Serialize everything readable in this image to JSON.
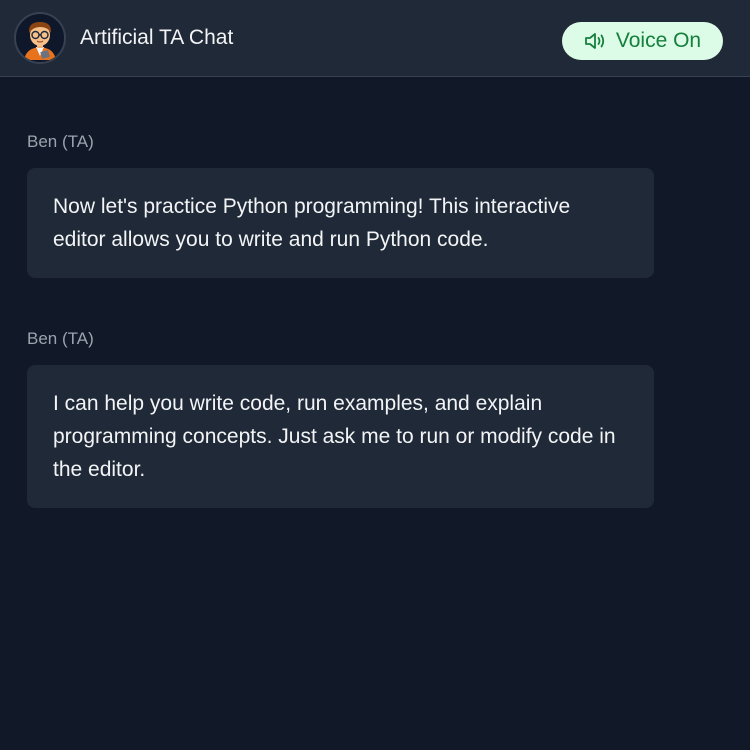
{
  "header": {
    "title": "Artificial TA Chat",
    "avatar_icon": "teacher-emoji-icon",
    "voice_button_label": "Voice On",
    "voice_icon": "speaker-icon"
  },
  "colors": {
    "background": "#111827",
    "header": "#1f2937",
    "bubble": "#1f2937",
    "voice_button_bg": "#dcfce7",
    "voice_button_text": "#15803d"
  },
  "messages": [
    {
      "sender": "Ben (TA)",
      "text": "Now let's practice Python programming! This interactive editor allows you to write and run Python code."
    },
    {
      "sender": "Ben (TA)",
      "text": "I can help you write code, run examples, and explain programming concepts. Just ask me to run or modify code in the editor."
    }
  ]
}
